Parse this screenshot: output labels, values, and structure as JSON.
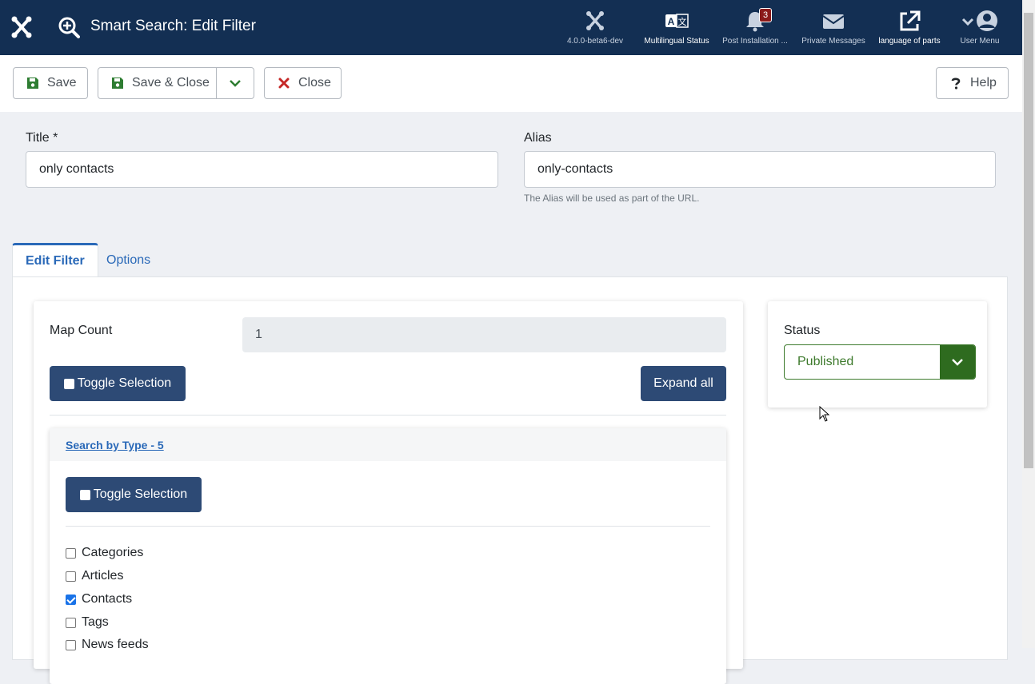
{
  "header": {
    "title": "Smart Search: Edit Filter",
    "items": [
      {
        "label": "4.0.0-beta6-dev",
        "icon": "joomla-icon"
      },
      {
        "label": "Multilingual Status",
        "icon": "language-icon"
      },
      {
        "label": "Post Installation ...",
        "icon": "bell-icon",
        "badge": "3"
      },
      {
        "label": "Private Messages",
        "icon": "envelope-icon"
      },
      {
        "label": "language of parts",
        "icon": "external-link-icon"
      },
      {
        "label": "User Menu",
        "icon": "user-icon"
      }
    ]
  },
  "toolbar": {
    "save": "Save",
    "save_close": "Save & Close",
    "close": "Close",
    "help": "Help"
  },
  "form": {
    "title_label": "Title *",
    "title_value": "only contacts",
    "alias_label": "Alias",
    "alias_value": "only-contacts",
    "alias_hint": "The Alias will be used as part of the URL."
  },
  "tabs": [
    {
      "label": "Edit Filter",
      "active": true
    },
    {
      "label": "Options",
      "active": false
    }
  ],
  "filter": {
    "map_count_label": "Map Count",
    "map_count_value": "1",
    "toggle_selection": "Toggle Selection",
    "expand_all": "Expand all",
    "group": {
      "title": "Search by Type - 5",
      "toggle_selection": "Toggle Selection",
      "items": [
        {
          "label": "Categories",
          "checked": false
        },
        {
          "label": "Articles",
          "checked": false
        },
        {
          "label": "Contacts",
          "checked": true
        },
        {
          "label": "Tags",
          "checked": false
        },
        {
          "label": "News feeds",
          "checked": false
        }
      ]
    }
  },
  "status": {
    "label": "Status",
    "value": "Published"
  },
  "colors": {
    "header_bg": "#132f53",
    "primary_button": "#2d4a75",
    "link": "#2a69b8",
    "published_green": "#3d7a2c",
    "close_red": "#c52827",
    "save_green": "#2e7d32"
  }
}
